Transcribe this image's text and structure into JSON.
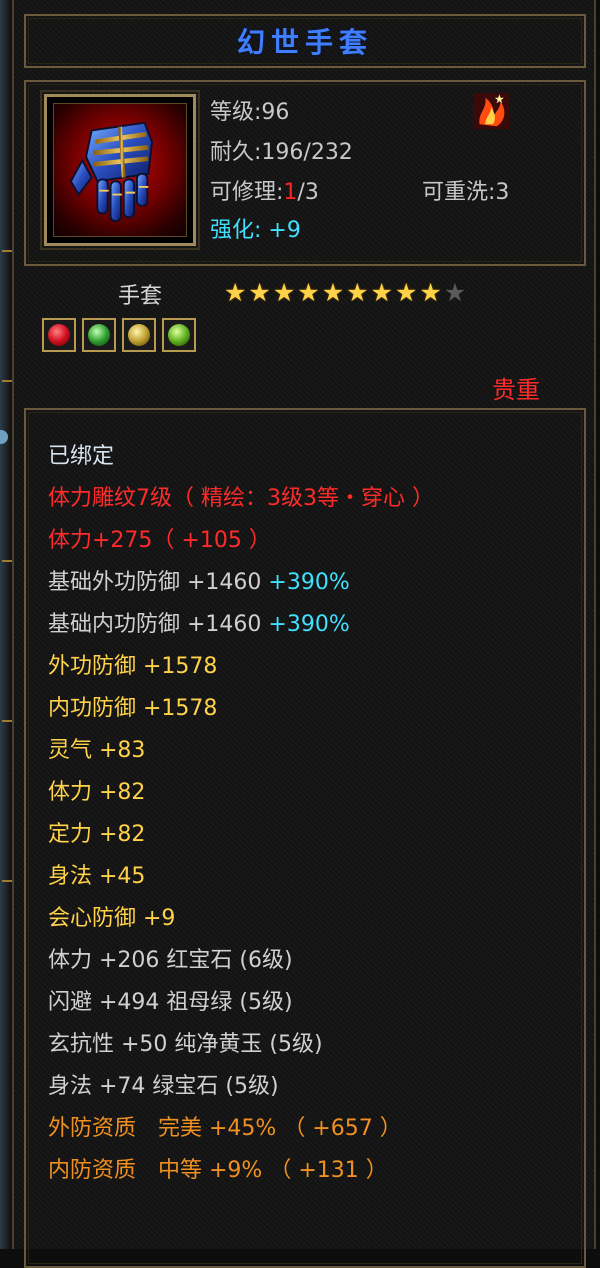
{
  "item": {
    "name": "幻世手套",
    "level_text": "等级:96",
    "durability_text": "耐久:196/232",
    "repair_label": "可修理:",
    "repair_used": "1",
    "repair_total": "/3",
    "rewash_text": "可重洗:3",
    "enhance_text": "强化: +9",
    "type": "手套",
    "star_rating": 9,
    "star_max": 10,
    "quality": "贵重",
    "badge_icon": "flame-badge-icon",
    "gems": [
      "red-gem-icon",
      "green-gem-icon",
      "yellow-gem-icon",
      "emerald-gem-icon"
    ]
  },
  "attributes": {
    "bound": "已绑定",
    "engraving": "体力雕纹7级（ 精绘：3级3等・穿心 ）",
    "engraving_bonus": "体力+275（ +105 ）",
    "base_ext_def": "基础外功防御 +1460",
    "base_ext_def_pct": "+390%",
    "base_int_def": "基础内功防御 +1460",
    "base_int_def_pct": "+390%",
    "ext_def": "外功防御 +1578",
    "int_def": "内功防御 +1578",
    "spirit": "灵气 +83",
    "stamina": "体力 +82",
    "focus": "定力 +82",
    "agility": "身法 +45",
    "crit_def": "会心防御 +9",
    "gem1": "体力 +206 红宝石 (6级)",
    "gem2": "闪避 +494 祖母绿 (5级)",
    "gem3": "玄抗性 +50 纯净黄玉 (5级)",
    "gem4": "身法 +74 绿宝石 (5级)",
    "ext_quality": "外防资质　完美 +45% （ +657 ）",
    "int_quality": "内防资质　中等 +9% （ +131 ）"
  },
  "colors": {
    "title": "#3f7fff",
    "frame": "#6a5a3c",
    "red": "#ff2a2a",
    "cyan": "#40e0ff",
    "yellow": "#ffd24a",
    "orange": "#f09020",
    "star_on": "#ffd24a",
    "star_off": "#5a5a5a"
  }
}
